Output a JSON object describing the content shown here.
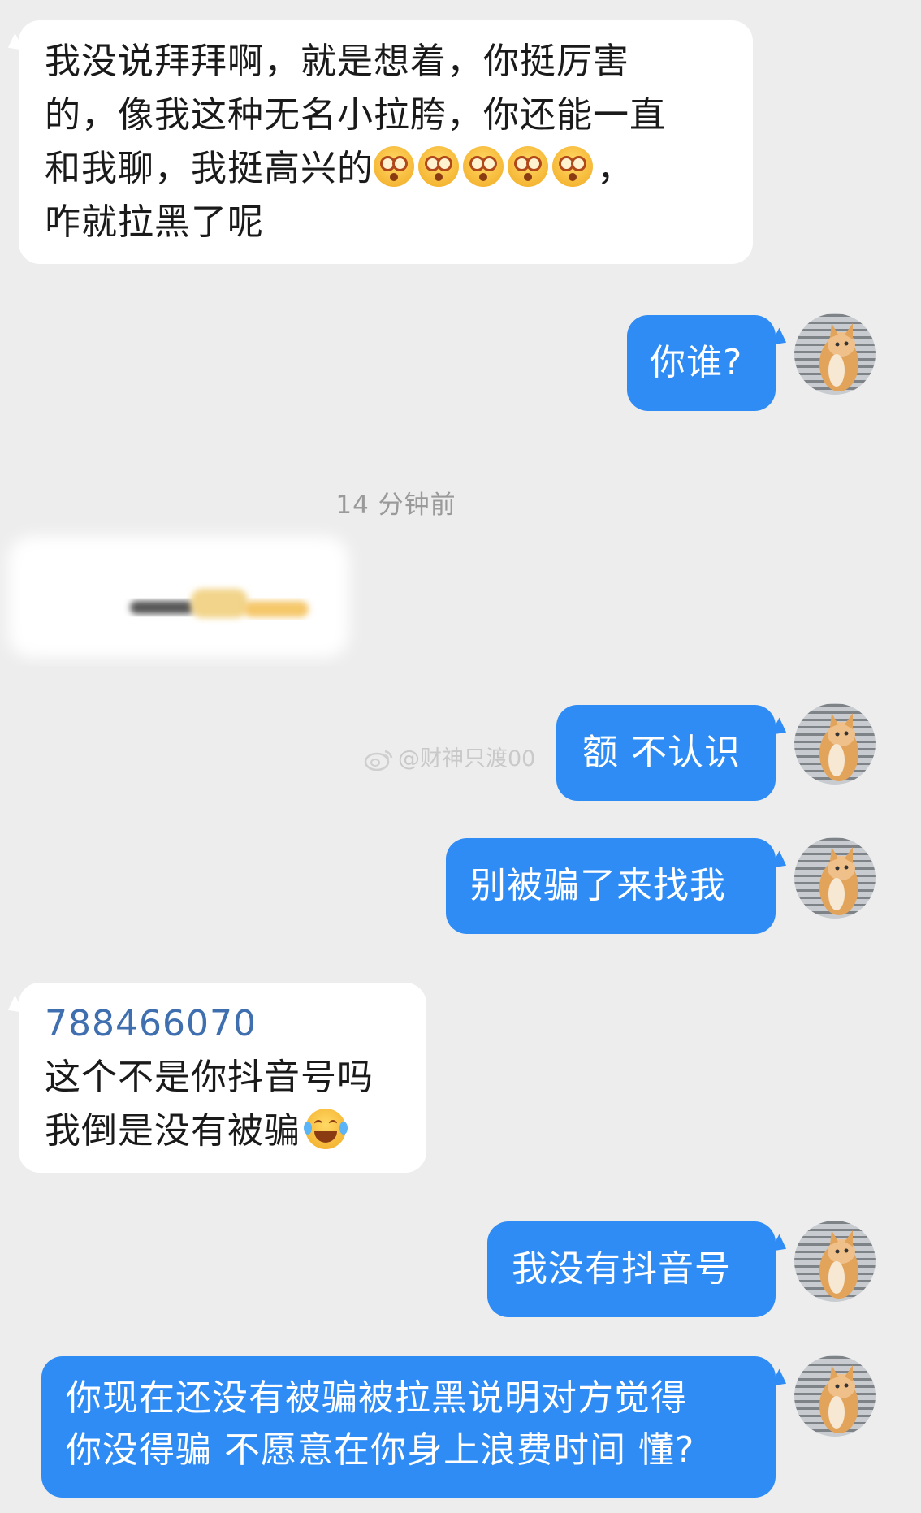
{
  "messages": [
    {
      "lines": [
        "我没说拜拜啊，就是想着，你挺厉害",
        "的，像我这种无名小拉胯，你还能一直",
        "和我聊，我挺高兴的",
        "，",
        "咋就拉黑了呢"
      ]
    },
    {
      "text": "你谁?"
    },
    {
      "text": "额 不认识"
    },
    {
      "text": "别被骗了来找我"
    },
    {
      "link": "788466070",
      "lines": [
        "这个不是你抖音号吗",
        "我倒是没有被骗"
      ]
    },
    {
      "text": "我没有抖音号"
    },
    {
      "lines": [
        "你现在还没有被骗被拉黑说明对方觉得",
        "你没得骗 不愿意在你身上浪费时间 懂?"
      ]
    }
  ],
  "timestamp": "14 分钟前",
  "watermark": "@财神只渡00",
  "icons": {
    "avatar": "cat-avatar",
    "dizzy_emoji": "dizzy-face-emoji",
    "laugh_emoji": "tears-of-joy-emoji",
    "watermark": "weibo-logo"
  },
  "colors": {
    "background": "#ededed",
    "incoming_bubble": "#ffffff",
    "outgoing_bubble": "#2f8cf5",
    "link": "#3f6fae"
  }
}
